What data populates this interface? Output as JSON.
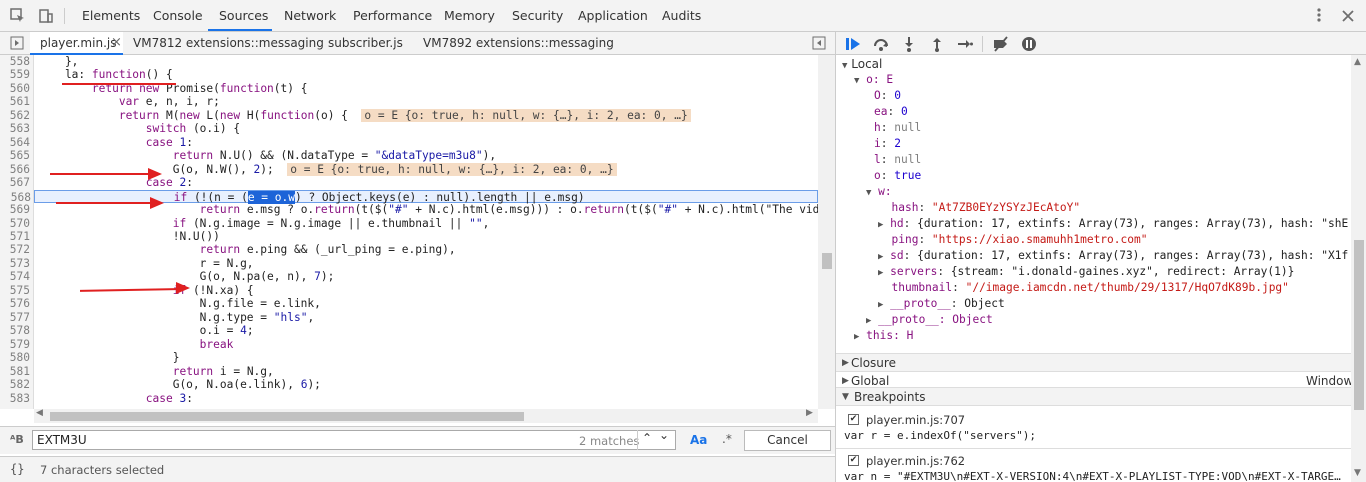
{
  "top_tabs": [
    "Elements",
    "Console",
    "Sources",
    "Network",
    "Performance",
    "Memory",
    "Security",
    "Application",
    "Audits"
  ],
  "active_top_tab": "Sources",
  "file_tabs": [
    "player.min.js",
    "VM7812 extensions::messaging",
    "subscriber.js",
    "VM7892 extensions::messaging"
  ],
  "file_tab_close": "×",
  "code_lines": [
    {
      "n": "558",
      "t": "    },"
    },
    {
      "n": "559",
      "t": "    la: function() {"
    },
    {
      "n": "560",
      "t": "        return new Promise(function(t) {"
    },
    {
      "n": "561",
      "t": "            var e, n, i, r;"
    },
    {
      "n": "562",
      "t": "            return M(new L(new H(function(o) {",
      "inline": "o = E {o: true, h: null, w: {…}, i: 2, ea: 0, …}"
    },
    {
      "n": "563",
      "t": "                switch (o.i) {"
    },
    {
      "n": "564",
      "t": "                case 1:"
    },
    {
      "n": "565",
      "t": "                    return N.U() && (N.dataType = \"&dataType=m3u8\"),"
    },
    {
      "n": "566",
      "t": "                    G(o, N.W(), 2);",
      "inline": "o = E {o: true, h: null, w: {…}, i: 2, ea: 0, …}"
    },
    {
      "n": "567",
      "t": "                case 2:"
    },
    {
      "n": "568",
      "t": "                    if (!(n = (e = o.w) ? Object.keys(e) : null).length || e.msg)"
    },
    {
      "n": "569",
      "t": "                        return e.msg ? o.return(t($(\"#\" + N.c).html(e.msg))) : o.return(t($(\"#\" + N.c).html(\"The video"
    },
    {
      "n": "570",
      "t": "                    if (N.g.image = N.g.image || e.thumbnail || \"\","
    },
    {
      "n": "571",
      "t": "                    !N.U())"
    },
    {
      "n": "572",
      "t": "                        return e.ping && (_url_ping = e.ping),"
    },
    {
      "n": "573",
      "t": "                        r = N.g,"
    },
    {
      "n": "574",
      "t": "                        G(o, N.pa(e, n), 7);"
    },
    {
      "n": "575",
      "t": "                    if (!N.xa) {"
    },
    {
      "n": "576",
      "t": "                        N.g.file = e.link,"
    },
    {
      "n": "577",
      "t": "                        N.g.type = \"hls\","
    },
    {
      "n": "578",
      "t": "                        o.i = 4;"
    },
    {
      "n": "579",
      "t": "                        break"
    },
    {
      "n": "580",
      "t": "                    }"
    },
    {
      "n": "581",
      "t": "                    return i = N.g,"
    },
    {
      "n": "582",
      "t": "                    G(o, N.oa(e.link), 6);"
    },
    {
      "n": "583",
      "t": "                case 3:"
    }
  ],
  "search": {
    "value": "EXTM3U",
    "matches": "2 matches",
    "aa": "Aa",
    "regex": ".*",
    "cancel": "Cancel"
  },
  "status": {
    "selected": "7 characters selected",
    "braces": "{}"
  },
  "scope": {
    "local_label": "Local",
    "o_label": "o: E",
    "props": [
      {
        "k": "O",
        "v": "0",
        "t": "num"
      },
      {
        "k": "ea",
        "v": "0",
        "t": "num"
      },
      {
        "k": "h",
        "v": "null",
        "t": "null"
      },
      {
        "k": "i",
        "v": "2",
        "t": "num"
      },
      {
        "k": "l",
        "v": "null",
        "t": "null"
      },
      {
        "k": "o",
        "v": "true",
        "t": "num"
      }
    ],
    "w_label": "w:",
    "w_props": [
      {
        "k": "hash",
        "v": "\"At7ZB0EYzYSYzJEcAtoY\"",
        "t": "str",
        "exp": false
      },
      {
        "k": "hd",
        "v": "{duration: 17, extinfs: Array(73), ranges: Array(73), hash: \"shE",
        "t": "obj",
        "exp": true
      },
      {
        "k": "ping",
        "v": "\"https://xiao.smamuhh1metro.com\"",
        "t": "str",
        "exp": false
      },
      {
        "k": "sd",
        "v": "{duration: 17, extinfs: Array(73), ranges: Array(73), hash: \"X1f",
        "t": "obj",
        "exp": true
      },
      {
        "k": "servers",
        "v": "{stream: \"i.donald-gaines.xyz\", redirect: Array(1)}",
        "t": "obj",
        "exp": true
      },
      {
        "k": "thumbnail",
        "v": "\"//image.iamcdn.net/thumb/29/1317/HqO7dK89b.jpg\"",
        "t": "str",
        "exp": false
      },
      {
        "k": "__proto__",
        "v": "Object",
        "t": "obj",
        "exp": true
      }
    ],
    "o_proto": "__proto__: Object",
    "this_label": "this: H",
    "closure": "Closure",
    "global": "Global",
    "global_val": "Window"
  },
  "breakpoints": {
    "header": "Breakpoints",
    "items": [
      {
        "file": "player.min.js:707",
        "code": "var r = e.indexOf(\"servers\");"
      },
      {
        "file": "player.min.js:762",
        "code": "var n = \"#EXTM3U\\n#EXT-X-VERSION:4\\n#EXT-X-PLAYLIST-TYPE:VOD\\n#EXT-X-TARGE…"
      }
    ]
  }
}
